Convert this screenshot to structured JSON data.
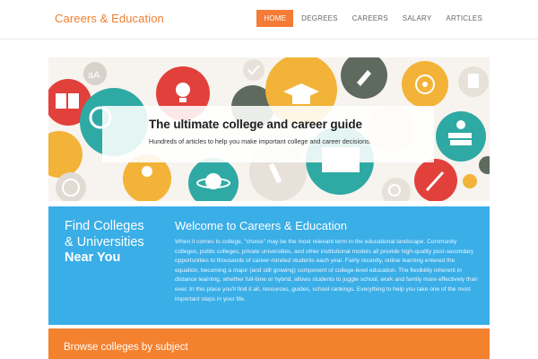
{
  "header": {
    "brand": "Careers & Education",
    "nav": [
      {
        "label": "HOME",
        "active": true
      },
      {
        "label": "DEGREES",
        "active": false
      },
      {
        "label": "CAREERS",
        "active": false
      },
      {
        "label": "SALARY",
        "active": false
      },
      {
        "label": "ARTICLES",
        "active": false
      }
    ]
  },
  "hero": {
    "title": "The ultimate college and career guide",
    "subtitle": "Hundreds of articles to help you make important college and career decisions.",
    "icon_text": "aA"
  },
  "intro": {
    "heading_line1": "Find Colleges",
    "heading_line2": "& Universities",
    "heading_line3": "Near You",
    "welcome_title": "Welcome to Careers & Education",
    "body": "When it comes to college, \"choice\" may be the most relevant term in the educational landscape. Community colleges, public colleges, private universities, and other institutional models all provide high-quality post-secondary opportunities to thousands of career-minded students each year. Fairly recently, online learning entered the equation, becoming a major (and still growing) component of college-level education. The flexibility inherent in distance learning, whether full-time or hybrid, allows students to juggle school, work and family more effectively than ever. In this place you'll find it all, resources, guides, school rankings. Everything to help you take one of the most important steps in your life."
  },
  "browse": {
    "title": "Browse colleges by subject"
  },
  "colors": {
    "brand": "#ef7f2e",
    "nav_active": "#f47c36",
    "blue_panel": "#3aaee7",
    "orange_panel": "#f4812e"
  }
}
